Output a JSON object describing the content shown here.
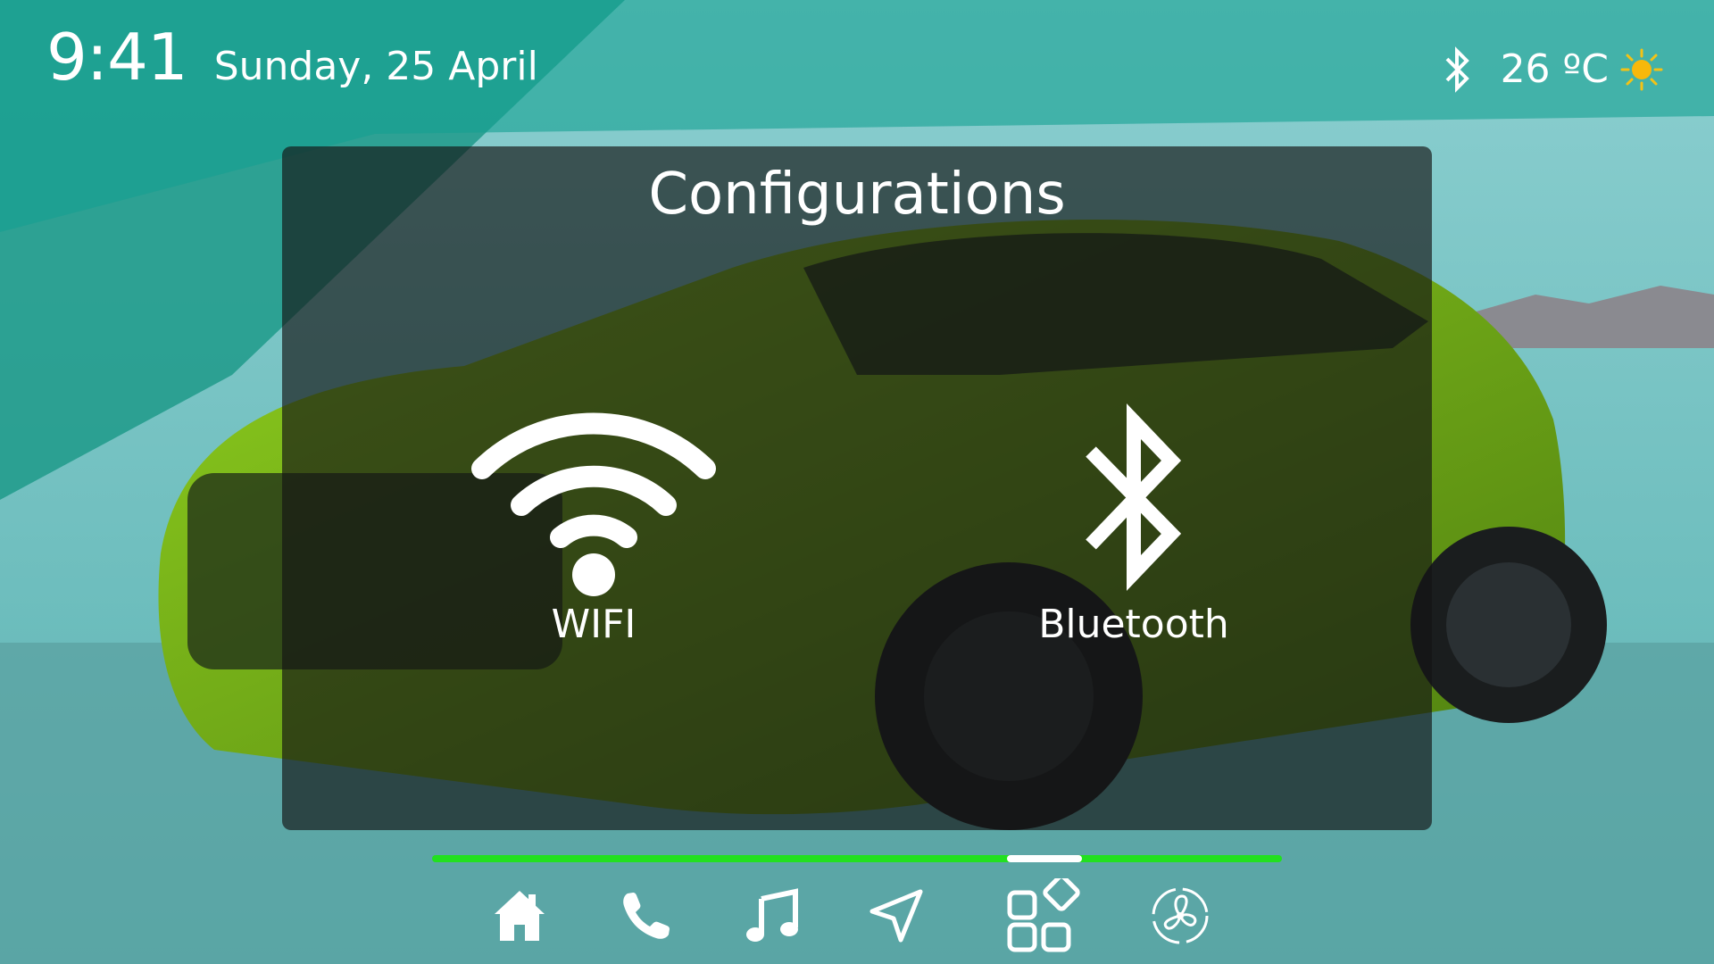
{
  "status_bar": {
    "time": "9:41",
    "date": "Sunday, 25 April",
    "temperature": "26 ºC",
    "icons": [
      "bluetooth-icon",
      "sun-icon"
    ]
  },
  "panel": {
    "title": "Configurations",
    "options": [
      {
        "label": "WIFI",
        "icon": "wifi-icon"
      },
      {
        "label": "Bluetooth",
        "icon": "bluetooth-icon"
      }
    ]
  },
  "pager": {
    "page_count": 1,
    "active_position": 0.72
  },
  "nav": {
    "items": [
      {
        "icon": "home-icon"
      },
      {
        "icon": "phone-icon"
      },
      {
        "icon": "music-icon"
      },
      {
        "icon": "navigation-icon"
      },
      {
        "icon": "apps-icon",
        "active": true
      },
      {
        "icon": "fan-icon"
      }
    ]
  },
  "colors": {
    "accent": "#22e01f",
    "panel_bg": "#141414",
    "text": "#ffffff"
  }
}
